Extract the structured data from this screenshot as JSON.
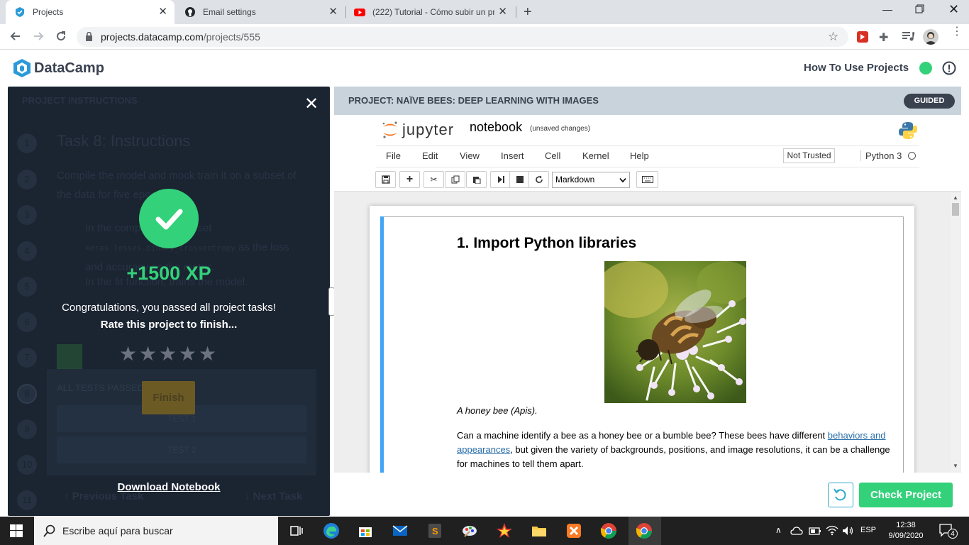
{
  "browser": {
    "tabs": [
      {
        "title": "Projects",
        "active": true
      },
      {
        "title": "Email settings",
        "active": false
      },
      {
        "title": "(222) Tutorial - Cómo subir un pr",
        "active": false
      }
    ],
    "new_tab": "+",
    "url_domain": "projects.datacamp.com",
    "url_path": "/projects/555"
  },
  "header": {
    "logo_text": "DataCamp",
    "how_to": "How To Use Projects",
    "status_color": "#33d17a"
  },
  "instructions_panel": {
    "section_label": "PROJECT INSTRUCTIONS",
    "task_title": "Task 8: Instructions",
    "task_text_1": "Compile the model and mock train it on a subset of the data for five epochs.",
    "bullet_1a": "In the compile function, set",
    "bullet_1b": "keras.losses.binary_crossentropy",
    "bullet_1c": "as the loss and accuracy as the metric.",
    "bullet_2": "In the fit function, trains the model.",
    "step_numbers": [
      "1",
      "2",
      "3",
      "4",
      "5",
      "6",
      "7",
      "8",
      "9",
      "10",
      "11"
    ],
    "tests_header": "ALL TESTS PASSED",
    "test_1": "TEST 1",
    "test_2": "TEST 2",
    "previous": "Previous Task",
    "next": "Next Task"
  },
  "modal": {
    "xp": "+1500 XP",
    "congrats": "Congratulations, you passed all project tasks!",
    "rate": "Rate this project to finish...",
    "rating": 0,
    "stars_total": 5,
    "finish": "Finish",
    "download": "Download Notebook"
  },
  "project": {
    "title": "PROJECT: NAÏVE BEES: DEEP LEARNING WITH IMAGES",
    "badge": "GUIDED"
  },
  "jupyter": {
    "logo_text": "jupyter",
    "notebook_name": "notebook",
    "unsaved": "(unsaved changes)",
    "menu": [
      "File",
      "Edit",
      "View",
      "Insert",
      "Cell",
      "Kernel",
      "Help"
    ],
    "trust": "Not Trusted",
    "kernel": "Python 3",
    "cell_type": "Markdown"
  },
  "notebook": {
    "heading": "1. Import Python libraries",
    "image_alt": "honey bee on white flower",
    "caption": "A honey bee (Apis).",
    "para_1": "Can a machine identify a bee as a honey bee or a bumble bee? These bees have different",
    "para_link": "behaviors and appearances",
    "para_2": ", but given the variety of backgrounds, positions, and image resolutions, it can be a challenge for machines to tell them apart."
  },
  "actions": {
    "check": "Check Project"
  },
  "taskbar": {
    "search_placeholder": "Escribe aquí para buscar",
    "language": "ESP",
    "time": "12:38",
    "date": "9/09/2020",
    "notifications": "4"
  }
}
